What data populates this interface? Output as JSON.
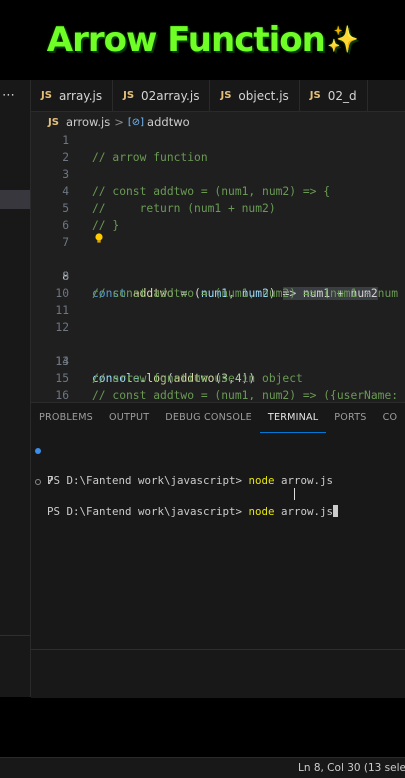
{
  "overlay_title": {
    "text": "Arrow Function",
    "emoji": "✨"
  },
  "sidebar": {
    "more_icon": "⋯"
  },
  "tabs": [
    {
      "icon": "JS",
      "label": "array.js"
    },
    {
      "icon": "JS",
      "label": "02array.js"
    },
    {
      "icon": "JS",
      "label": "object.js"
    },
    {
      "icon": "JS",
      "label": "02_d"
    }
  ],
  "breadcrumb": {
    "file": "arrow.js",
    "file_icon": "JS",
    "separator": ">",
    "symbol_icon": "[⊘]",
    "symbol": "addtwo"
  },
  "code": {
    "line_numbers": [
      "1",
      "2",
      "3",
      "4",
      "5",
      "6",
      "7",
      "8",
      "9",
      "10",
      "11",
      "12",
      "13",
      "14",
      "15",
      "16"
    ],
    "lines": {
      "l2": "// arrow function",
      "l4": "// const addtwo = (num1, num2) => {",
      "l5": "//     return (num1 + num2)",
      "l6": "// }",
      "l8_kw": "const",
      "l8_name": "addtwo",
      "l8_eq": " = (",
      "l8_p1": "num1",
      "l8_comma": ", ",
      "l8_p2": "num2",
      "l8_close": ") ",
      "l8_selected": "=> num1 + num2",
      "l10": "// const addtwo = (num1, num2) => (num1 + num",
      "l13_obj": "console",
      "l13_dot": ".",
      "l13_fn": "log",
      "l13_open": "(",
      "l13_call": "addtwo",
      "l13_args_open": "(",
      "l13_a": "3",
      "l13_comma": ",",
      "l13_b": "4",
      "l13_close": "))",
      "l15": "// arrow function use in object",
      "l16": "// const addtwo = (num1, num2) => ({userName:"
    }
  },
  "panel": {
    "tabs": [
      "PROBLEMS",
      "OUTPUT",
      "DEBUG CONSOLE",
      "TERMINAL",
      "PORTS",
      "CO"
    ],
    "active_tab": "TERMINAL",
    "terminal": {
      "line1_prompt": "PS D:\\Fantend work\\javascript> ",
      "line1_cmd": "node",
      "line1_arg": " arrow.js",
      "output": "7",
      "line2_prompt": "PS D:\\Fantend work\\javascript> ",
      "line2_cmd": "node",
      "line2_arg": " arrow.js"
    }
  },
  "status_bar": {
    "position": "Ln 8, Col 30 (13 sele"
  },
  "colors": {
    "title": "#6fff26",
    "accent": "#0078d4",
    "js_icon": "#e5c07b"
  }
}
